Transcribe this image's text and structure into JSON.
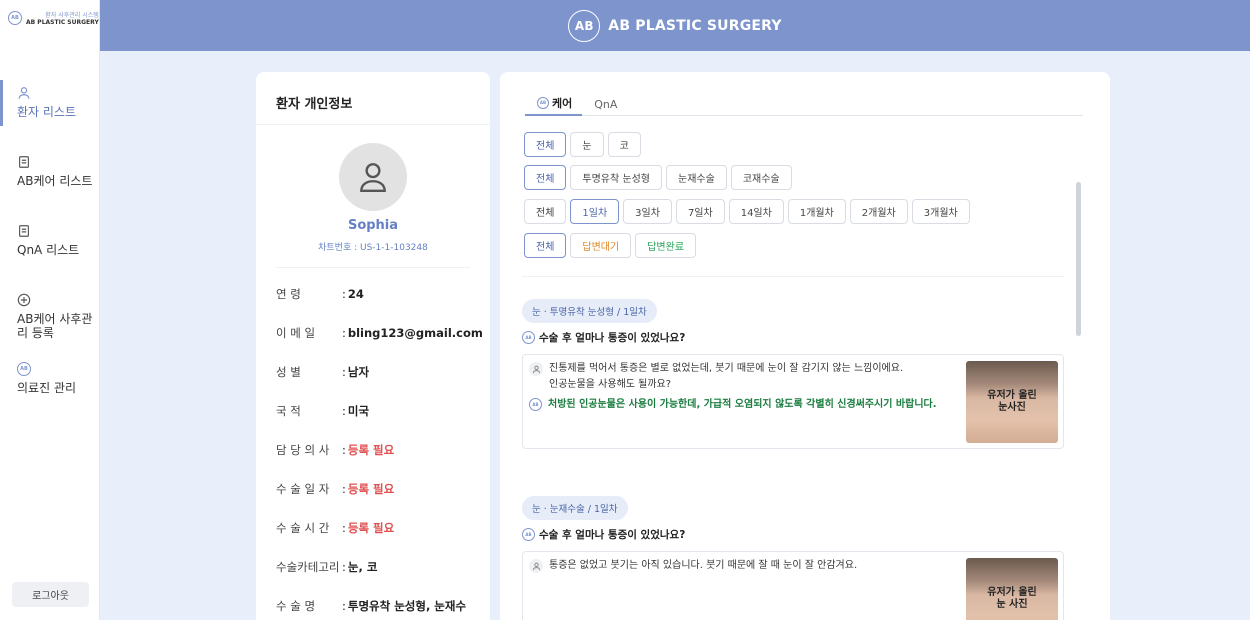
{
  "header": {
    "title": "AB PLASTIC SURGERY",
    "logo_text": "AB"
  },
  "sidebar": {
    "brand_sub": "환자 사후관리 시스템",
    "brand_name": "AB PLASTIC SURGERY",
    "logo_text": "AB",
    "items": [
      {
        "label": "환자 리스트",
        "icon": "person-icon",
        "active": true
      },
      {
        "label": "AB케어 리스트",
        "icon": "document-icon",
        "active": false
      },
      {
        "label": "QnA 리스트",
        "icon": "document-icon",
        "active": false
      },
      {
        "label": "AB케어 사후관리 등록",
        "icon": "plus-circle-icon",
        "active": false
      },
      {
        "label": "의료진 관리",
        "icon": "ab-logo-icon",
        "active": false
      }
    ],
    "logout_label": "로그아웃"
  },
  "patient": {
    "card_title": "환자 개인정보",
    "name": "Sophia",
    "chart_no": "차트번호 : US-1-1-103248",
    "fields": [
      {
        "label": "연 령",
        "value": "24",
        "need": false
      },
      {
        "label": "이 메 일",
        "value": "bling123@gmail.com",
        "need": false
      },
      {
        "label": "성 별",
        "value": "남자",
        "need": false
      },
      {
        "label": "국 적",
        "value": "미국",
        "need": false
      },
      {
        "label": "담 당 의 사",
        "value": "등록 필요",
        "need": true
      },
      {
        "label": "수 술 일 자",
        "value": "등록 필요",
        "need": true
      },
      {
        "label": "수 술 시 간",
        "value": "등록 필요",
        "need": true
      },
      {
        "label": "수술카테고리",
        "value": "눈, 코",
        "need": false
      },
      {
        "label": "수 술 명",
        "value": "투명유착 눈성형, 눈재수",
        "need": false
      }
    ]
  },
  "tabs": [
    {
      "label": "케어",
      "active": true
    },
    {
      "label": "QnA",
      "active": false
    }
  ],
  "filters": {
    "category": [
      "전체",
      "눈",
      "코"
    ],
    "surgery": [
      "전체",
      "투명유착 눈성형",
      "눈재수술",
      "코재수술"
    ],
    "period": [
      "전체",
      "1일차",
      "3일차",
      "7일차",
      "14일차",
      "1개월차",
      "2개월차",
      "3개월차"
    ],
    "status": [
      "전체",
      "답변대기",
      "답변완료"
    ]
  },
  "qa_items": [
    {
      "tag": "눈 · 투명유착 눈성형 / 1일차",
      "question": "수술 후 얼마나 통증이 있었나요?",
      "user_text": "진통제를 먹어서 통증은 별로 없었는데, 붓기 때문에 눈이 잘 감기지 않는 느낌이에요.\n인공눈물을 사용해도 될까요?",
      "answer": "처방된 인공눈물은 사용이 가능한데, 가급적 오염되지 않도록 각별히 신경써주시기 바랍니다.",
      "photo_caption": "유저가 올린\n눈사진"
    },
    {
      "tag": "눈 · 눈재수술 / 1일차",
      "question": "수술 후 얼마나 통증이 있었나요?",
      "user_text": "통증은 없었고 붓기는 아직 있습니다. 붓기 때문에 잘 때 눈이 잘 안감겨요.",
      "answer": "",
      "photo_caption": "유저가 올린\n눈 사진"
    }
  ],
  "colors": {
    "accent": "#7d94cd",
    "need": "#e05050",
    "wait": "#e08b29",
    "done": "#2aa45a"
  }
}
